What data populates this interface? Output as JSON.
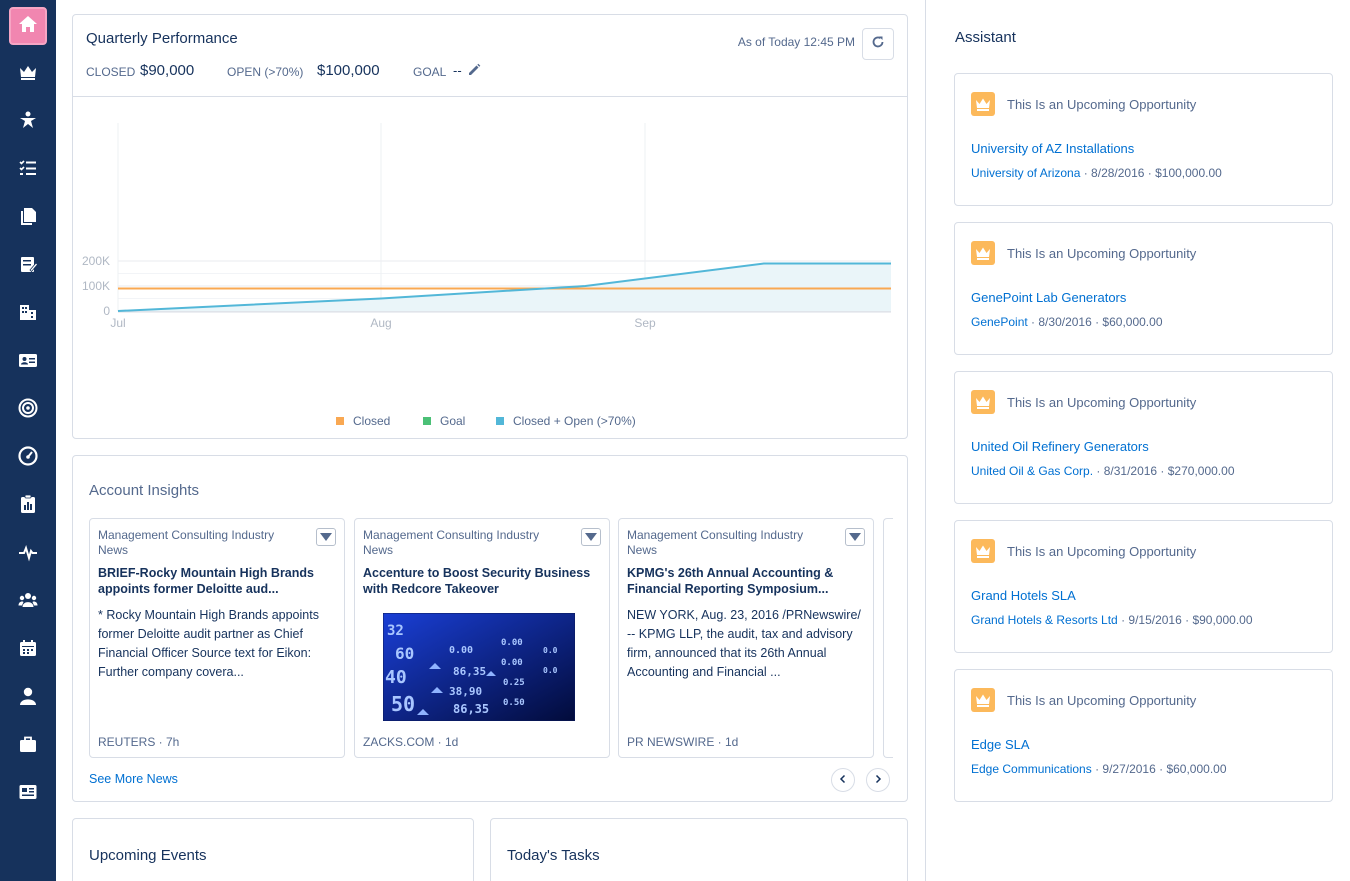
{
  "sidebar": {
    "items": [
      {
        "icon": "home-icon",
        "active": true
      },
      {
        "icon": "crown-icon"
      },
      {
        "icon": "person-star-icon"
      },
      {
        "icon": "task-list-icon"
      },
      {
        "icon": "files-icon"
      },
      {
        "icon": "notes-icon"
      },
      {
        "icon": "building-icon"
      },
      {
        "icon": "contact-card-icon"
      },
      {
        "icon": "target-icon"
      },
      {
        "icon": "gauge-icon"
      },
      {
        "icon": "clipboard-chart-icon"
      },
      {
        "icon": "pulse-icon"
      },
      {
        "icon": "group-icon"
      },
      {
        "icon": "calendar-icon"
      },
      {
        "icon": "user-icon"
      },
      {
        "icon": "briefcase-icon"
      },
      {
        "icon": "news-icon"
      }
    ]
  },
  "quarterly": {
    "title": "Quarterly Performance",
    "as_of": "As of Today 12:45 PM",
    "closed_label": "CLOSED",
    "closed_value": "$90,000",
    "open_label": "OPEN (>70%)",
    "open_value": "$100,000",
    "goal_label": "GOAL",
    "goal_value": "--"
  },
  "chart_data": {
    "type": "area",
    "x_ticks": [
      "Jul",
      "Aug",
      "Sep"
    ],
    "y_ticks": [
      "0",
      "100K",
      "200K"
    ],
    "ylim": [
      0,
      200000
    ],
    "legend": [
      "Closed",
      "Goal",
      "Closed + Open (>70%)"
    ],
    "series": [
      {
        "name": "Closed",
        "color": "#f9a852",
        "points": [
          [
            "Jul 1",
            90000
          ],
          [
            "Sep 30",
            90000
          ]
        ]
      },
      {
        "name": "Goal",
        "color": "#4bc076",
        "points": []
      },
      {
        "name": "Closed + Open (>70%)",
        "color": "#52b7d8",
        "points": [
          [
            "Jul 1",
            0
          ],
          [
            "Aug 1",
            50000
          ],
          [
            "Aug 25",
            100000
          ],
          [
            "Sep 15",
            190000
          ],
          [
            "Sep 30",
            190000
          ]
        ]
      }
    ]
  },
  "insights": {
    "title": "Account Insights",
    "see_more": "See More News",
    "news": [
      {
        "category": "Management Consulting Industry News",
        "headline": "BRIEF-Rocky Mountain High Brands appoints former Deloitte aud...",
        "body": "* Rocky Mountain High Brands appoints former Deloitte audit partner as Chief Financial Officer Source text for Eikon: Further company covera...",
        "source": "REUTERS · 7h"
      },
      {
        "category": "Management Consulting Industry News",
        "headline": "Accenture to Boost Security Business with Redcore Takeover",
        "body": "",
        "source": "ZACKS.COM · 1d"
      },
      {
        "category": "Management Consulting Industry News",
        "headline": "KPMG's 26th Annual Accounting & Financial Reporting Symposium...",
        "body": "NEW YORK, Aug. 23, 2016 /PRNewswire/ -- KPMG LLP, the audit, tax and advisory firm, announced that its 26th Annual Accounting and Financial ...",
        "source": "PR NEWSWIRE · 1d"
      }
    ]
  },
  "events": {
    "title": "Upcoming Events"
  },
  "tasks": {
    "title": "Today's Tasks"
  },
  "assistant": {
    "title": "Assistant",
    "opportunities": [
      {
        "header": "This Is an Upcoming Opportunity",
        "name": "University of AZ Installations",
        "account": "University of Arizona",
        "details": " · 8/28/2016 · $100,000.00"
      },
      {
        "header": "This Is an Upcoming Opportunity",
        "name": "GenePoint Lab Generators",
        "account": "GenePoint",
        "details": " · 8/30/2016 · $60,000.00"
      },
      {
        "header": "This Is an Upcoming Opportunity",
        "name": "United Oil Refinery Generators",
        "account": "United Oil & Gas Corp.",
        "details": " · 8/31/2016 · $270,000.00"
      },
      {
        "header": "This Is an Upcoming Opportunity",
        "name": "Grand Hotels SLA",
        "account": "Grand Hotels & Resorts Ltd",
        "details": " · 9/15/2016 · $90,000.00"
      },
      {
        "header": "This Is an Upcoming Opportunity",
        "name": "Edge SLA",
        "account": "Edge Communications",
        "details": " · 9/27/2016 · $60,000.00"
      }
    ]
  }
}
